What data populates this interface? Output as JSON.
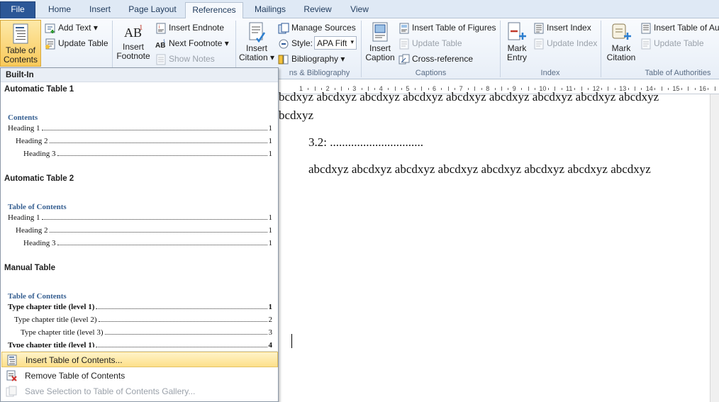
{
  "tabs": [
    "File",
    "Home",
    "Insert",
    "Page Layout",
    "References",
    "Mailings",
    "Review",
    "View"
  ],
  "ribbon": {
    "toc_line1": "Table of",
    "toc_line2": "Contents",
    "add_text": "Add Text",
    "update_table": "Update Table",
    "insert_footnote_1": "Insert",
    "insert_footnote_2": "Footnote",
    "insert_endnote": "Insert Endnote",
    "next_footnote": "Next Footnote",
    "show_notes": "Show Notes",
    "insert_citation_1": "Insert",
    "insert_citation_2": "Citation",
    "manage_sources": "Manage Sources",
    "style_label": "Style:",
    "style_value": "APA Fifth",
    "bibliography": "Bibliography",
    "group_citations": "ns & Bibliography",
    "insert_caption_1": "Insert",
    "insert_caption_2": "Caption",
    "insert_table_of_figures": "Insert Table of Figures",
    "update_table_figures": "Update Table",
    "cross_reference": "Cross-reference",
    "group_captions": "Captions",
    "mark_entry_1": "Mark",
    "mark_entry_2": "Entry",
    "insert_index": "Insert Index",
    "update_index": "Update Index",
    "group_index": "Index",
    "mark_citation_1": "Mark",
    "mark_citation_2": "Citation",
    "insert_table_of_authorities": "Insert Table of Aut",
    "update_table_authorities": "Update Table",
    "group_authorities": "Table of Authorities"
  },
  "ruler": [
    "1",
    "2",
    "3",
    "4",
    "5",
    "6",
    "7",
    "8",
    "9",
    "10",
    "11",
    "12",
    "13",
    "14",
    "15",
    "16"
  ],
  "document": {
    "line1": "bcdxyz abcdxyz abcdxyz abcdxyz abcdxyz abcdxyz abcdxyz abcdxyz abcdxyz",
    "line2": "bcdxyz",
    "heading": "3.2: ...............................",
    "para": "abcdxyz abcdxyz abcdxyz abcdxyz abcdxyz abcdxyz abcdxyz abcdxyz"
  },
  "dropdown": {
    "header": "Built-In",
    "auto1": {
      "title": "Automatic Table 1",
      "toc_title": "Contents",
      "rows": [
        {
          "label": "Heading 1",
          "page": "1"
        },
        {
          "label": "Heading 2",
          "page": "1"
        },
        {
          "label": "Heading 3",
          "page": "1"
        }
      ]
    },
    "auto2": {
      "title": "Automatic Table 2",
      "toc_title": "Table of Contents",
      "rows": [
        {
          "label": "Heading 1",
          "page": "1"
        },
        {
          "label": "Heading 2",
          "page": "1"
        },
        {
          "label": "Heading 3",
          "page": "1"
        }
      ]
    },
    "manual": {
      "title": "Manual Table",
      "toc_title": "Table of Contents",
      "rows": [
        {
          "label": "Type chapter title (level 1)",
          "page": "1"
        },
        {
          "label": "Type chapter title (level 2)",
          "page": "2"
        },
        {
          "label": "Type chapter title (level 3)",
          "page": "3"
        },
        {
          "label": "Type chapter title (level 1)",
          "page": "4"
        }
      ]
    },
    "menu": {
      "insert_toc": "Insert Table of Contents...",
      "remove_toc": "Remove Table of Contents",
      "save_selection": "Save Selection to Table of Contents Gallery..."
    }
  }
}
